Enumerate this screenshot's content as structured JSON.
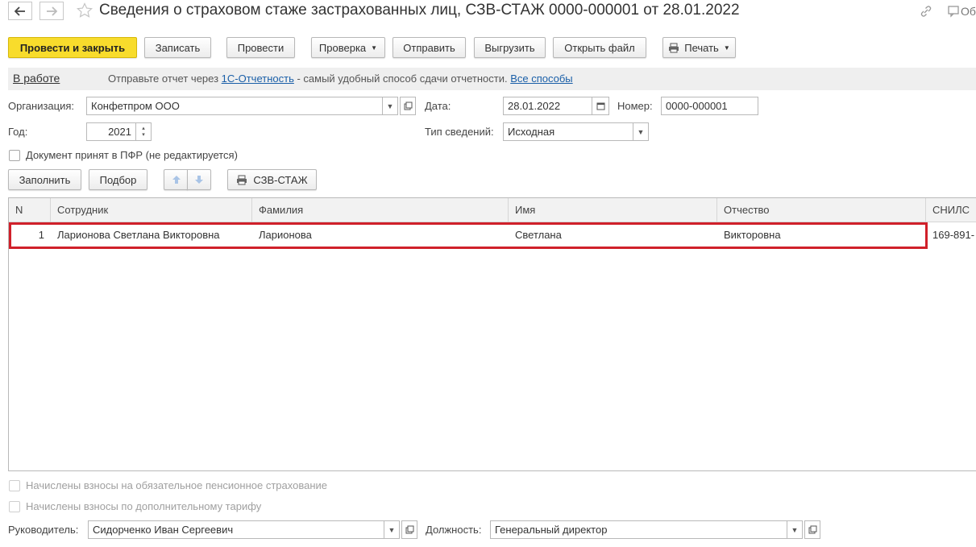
{
  "nav": {
    "back_icon": "arrow-left-icon",
    "forward_icon": "arrow-right-icon",
    "favorite_icon": "star-icon"
  },
  "window": {
    "title": "Сведения о страховом стаже застрахованных лиц, СЗВ-СТАЖ 0000-000001 от 28.01.2022",
    "right_text": "Об"
  },
  "toolbar": {
    "post_close": "Провести и закрыть",
    "save": "Записать",
    "post": "Провести",
    "check": "Проверка",
    "send": "Отправить",
    "export": "Выгрузить",
    "open_file": "Открыть файл",
    "print": "Печать"
  },
  "status": {
    "state": "В работе",
    "msg_prefix": "Отправьте отчет через ",
    "msg_link": "1С-Отчетность",
    "msg_suffix": " - самый удобный способ сдачи отчетности. ",
    "all_methods": "Все способы"
  },
  "form": {
    "org_label": "Организация:",
    "org_value": "Конфетпром ООО",
    "date_label": "Дата:",
    "date_value": "28.01.2022",
    "number_label": "Номер:",
    "number_value": "0000-000001",
    "year_label": "Год:",
    "year_value": "2021",
    "type_label": "Тип сведений:",
    "type_value": "Исходная",
    "accepted_label": "Документ принят в ПФР (не редактируется)"
  },
  "table_toolbar": {
    "fill": "Заполнить",
    "select": "Подбор",
    "print_form": "СЗВ-СТАЖ"
  },
  "table": {
    "columns": [
      "N",
      "Сотрудник",
      "Фамилия",
      "Имя",
      "Отчество",
      "СНИЛС"
    ],
    "rows": [
      {
        "n": "1",
        "employee": "Ларионова Светлана Викторовна",
        "last": "Ларионова",
        "first": "Светлана",
        "middle": "Викторовна",
        "snils": "169-891-"
      }
    ]
  },
  "bottom": {
    "pension_label": "Начислены взносы на обязательное пенсионное страхование",
    "additional_label": "Начислены взносы по дополнительному тарифу",
    "head_label": "Руководитель:",
    "head_value": "Сидорченко Иван Сергеевич",
    "position_label": "Должность:",
    "position_value": "Генеральный директор"
  },
  "colors": {
    "primary_button": "#f8dc2c",
    "highlight_border": "#d0202a",
    "link": "#1a5fa8"
  }
}
